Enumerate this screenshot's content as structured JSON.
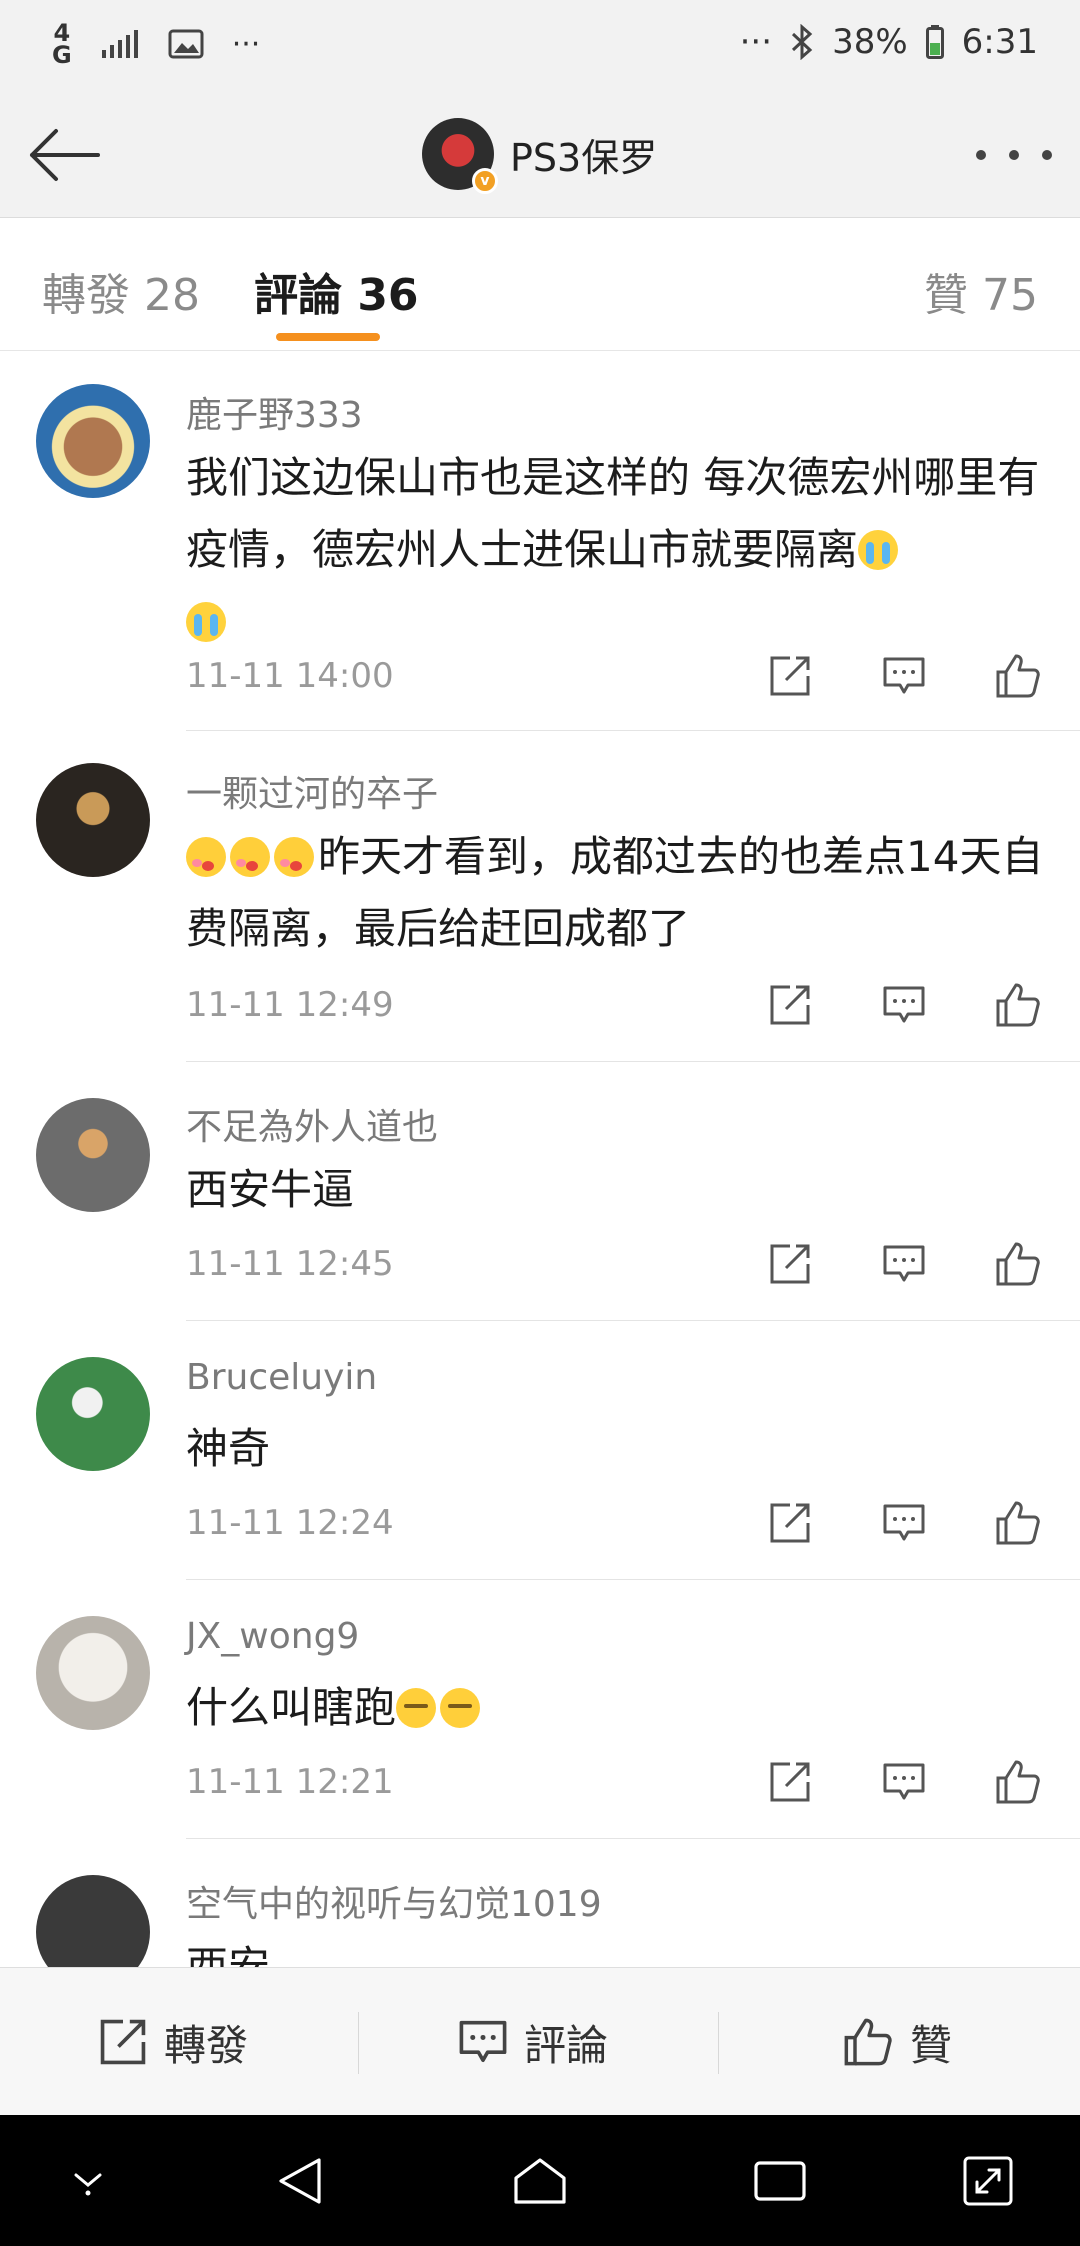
{
  "status_bar": {
    "network": "4G",
    "more": "···",
    "more_right": "···",
    "battery": "38%",
    "time": "6:31",
    "icons": [
      "lte-icon",
      "signal-icon",
      "image-icon",
      "bluetooth-icon",
      "battery-icon"
    ]
  },
  "header": {
    "title": "PS3保罗",
    "verified_badge": "v"
  },
  "tabs": {
    "repost": "轉發 28",
    "comment": "評論 36",
    "like": "贊 75"
  },
  "comments": [
    {
      "user": "鹿子野333",
      "text": "我们这边保山市也是这样的 每次德宏州哪里有疫情，德宏州人士进保山市就要隔离",
      "time": "11-11 14:00"
    },
    {
      "user": "一颗过河的卒子",
      "text": "昨天才看到，成都过去的也差点14天自费隔离，最后给赶回成都了",
      "time": "11-11 12:49"
    },
    {
      "user": "不足為外人道也",
      "text": "西安牛逼",
      "time": "11-11 12:45"
    },
    {
      "user": "Bruceluyin",
      "text": "神奇",
      "time": "11-11 12:24"
    },
    {
      "user": "JX_wong9",
      "text": "什么叫瞎跑",
      "time": "11-11 12:21"
    },
    {
      "user": "空气中的视听与幻觉1019",
      "text": "西安",
      "time": ""
    }
  ],
  "bottom_bar": {
    "repost": "轉發",
    "comment": "評論",
    "like": "贊"
  },
  "colors": {
    "accent": "#f5901e",
    "background": "#ffffff",
    "bar": "#f2f2f2",
    "secondary_text": "#8a8a8a"
  }
}
